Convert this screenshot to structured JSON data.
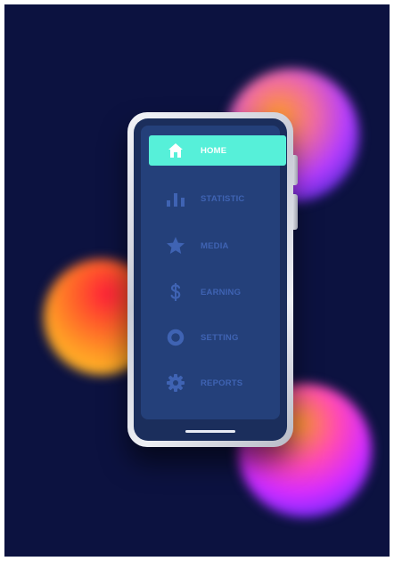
{
  "colors": {
    "background": "#0c1240",
    "panel": "#24407a",
    "active_item": "#56f0d9",
    "inactive_text": "#3f63b3",
    "active_text": "#ffffff"
  },
  "menu": {
    "items": [
      {
        "label": "HOME",
        "icon": "home-icon",
        "active": true
      },
      {
        "label": "STATISTIC",
        "icon": "bar-chart-icon",
        "active": false
      },
      {
        "label": "MEDIA",
        "icon": "star-icon",
        "active": false
      },
      {
        "label": "EARNING",
        "icon": "dollar-icon",
        "active": false
      },
      {
        "label": "SETTING",
        "icon": "ring-icon",
        "active": false
      },
      {
        "label": "REPORTS",
        "icon": "gear-icon",
        "active": false
      }
    ]
  }
}
